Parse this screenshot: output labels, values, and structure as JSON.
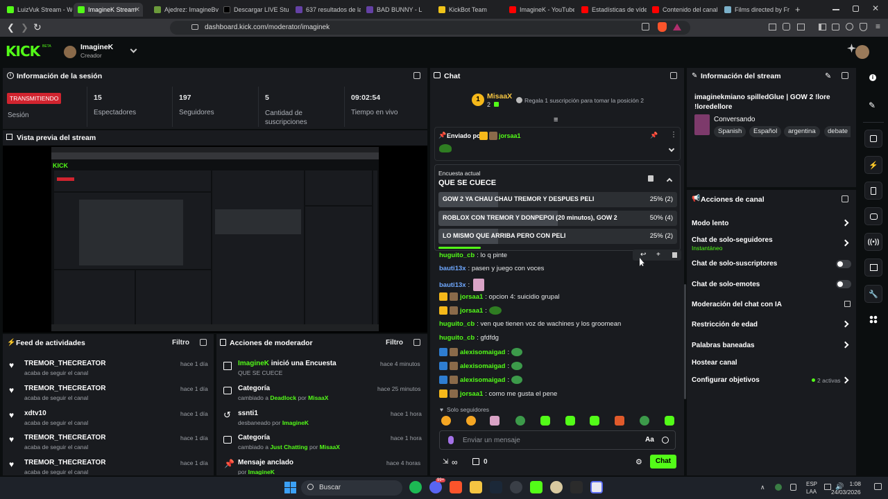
{
  "browser": {
    "tabs": [
      {
        "label": "LuizVuk Stream - W",
        "color": "#53fc18"
      },
      {
        "label": "ImagineK Stream",
        "color": "#53fc18"
      },
      {
        "label": "Ajedrez: ImagineBv",
        "color": "#6b9a3b"
      },
      {
        "label": "Descargar LIVE Stud",
        "color": "#000000"
      },
      {
        "label": "637 resultados de la",
        "color": "#6441a5"
      },
      {
        "label": "BAD BUNNY - L",
        "color": "#6441a5"
      },
      {
        "label": "KickBot Team",
        "color": "#f0c419"
      },
      {
        "label": "ImagineK - YouTube",
        "color": "#ff0000"
      },
      {
        "label": "Estadísticas de víde",
        "color": "#ff0000"
      },
      {
        "label": "Contenido del canal",
        "color": "#ff0000"
      },
      {
        "label": "Films directed by Fr",
        "color": "#7bb0c9"
      }
    ],
    "url": "dashboard.kick.com/moderator/imaginek"
  },
  "header": {
    "logo": "KICK",
    "logo_beta": "BETA",
    "user": "ImagineK",
    "role": "Creador"
  },
  "session": {
    "title": "Información de la sesión",
    "live_badge": "TRANSMITIENDO",
    "session_label": "Sesión",
    "stats": [
      {
        "value": "15",
        "label": "Espectadores"
      },
      {
        "value": "197",
        "label": "Seguidores"
      },
      {
        "value": "5",
        "label": "Cantidad de suscripciones"
      },
      {
        "value": "09:02:54",
        "label": "Tiempo en vivo"
      }
    ]
  },
  "preview": {
    "title": "Vista previa del stream"
  },
  "activity": {
    "title": "Feed de actividades",
    "filter": "Filtro",
    "items": [
      {
        "name": "TREMOR_THECREATOR",
        "sub": "acaba de seguir el canal",
        "time": "hace 1 día"
      },
      {
        "name": "TREMOR_THECREATOR",
        "sub": "acaba de seguir el canal",
        "time": "hace 1 día"
      },
      {
        "name": "xdtv10",
        "sub": "acaba de seguir el canal",
        "time": "hace 1 día"
      },
      {
        "name": "TREMOR_THECREATOR",
        "sub": "acaba de seguir el canal",
        "time": "hace 1 día"
      },
      {
        "name": "TREMOR_THECREATOR",
        "sub": "acaba de seguir el canal",
        "time": "hace 1 día"
      }
    ]
  },
  "modactions": {
    "title": "Acciones de moderador",
    "filter": "Filtro",
    "items": [
      {
        "title_user": "ImagineK",
        "title_rest": " inició una Encuesta",
        "sub_pre": "QUE SE CUECE",
        "sub_hl": "",
        "sub_mid": "",
        "sub_hl2": "",
        "time": "hace 4 minutos"
      },
      {
        "title_user": "",
        "title_rest": "Categoría",
        "sub_pre": "cambiado a ",
        "sub_hl": "Deadlock",
        "sub_mid": " por ",
        "sub_hl2": "MisaaX",
        "time": "hace 25 minutos"
      },
      {
        "title_user": "",
        "title_rest": "ssnti1",
        "sub_pre": "desbaneado por ",
        "sub_hl": "ImagineK",
        "sub_mid": "",
        "sub_hl2": "",
        "time": "hace 1 hora"
      },
      {
        "title_user": "",
        "title_rest": "Categoría",
        "sub_pre": "cambiado a ",
        "sub_hl": "Just Chatting",
        "sub_mid": " por ",
        "sub_hl2": "MisaaX",
        "time": "hace 1 hora"
      },
      {
        "title_user": "",
        "title_rest": "Mensaje anclado",
        "sub_pre": "por ",
        "sub_hl": "ImagineK",
        "sub_mid": "",
        "sub_hl2": "",
        "time": "hace 4 horas"
      }
    ]
  },
  "chat": {
    "title": "Chat",
    "top_gifter": "MisaaX",
    "top_gifter_count": "2",
    "gift_text": "Regala 1 suscripción para tomar la posición 2",
    "pinned_label": "Enviado por",
    "pinned_user": "jorsaa1",
    "poll": {
      "label": "Encuesta actual",
      "question": "QUE SE CUECE",
      "options": [
        {
          "text": "GOW 2 YA CHAU CHAU TREMOR Y DESPUES PELI",
          "pct": "25% (2)",
          "value": 0.25
        },
        {
          "text": "ROBLOX CON TREMOR Y DONPEPOI (20 minutos), GOW 2",
          "pct": "50% (4)",
          "value": 0.5
        },
        {
          "text": "LO MISMO QUE ARRIBA PERO CON PELI",
          "pct": "25% (2)",
          "value": 0.25
        }
      ]
    },
    "messages": [
      {
        "user": "huguito_cb",
        "color": "#53fc18",
        "text": ": lo q pinte"
      },
      {
        "user": "bauti13x",
        "color": "#6fa8ff",
        "text": ": pasen y juego con voces"
      },
      {
        "user": "bauti13x",
        "color": "#6fa8ff",
        "text": ":"
      },
      {
        "user": "jorsaa1",
        "color": "#53fc18",
        "text": ": opcion 4: suicidio grupal"
      },
      {
        "user": "jorsaa1",
        "color": "#53fc18",
        "text": ":"
      },
      {
        "user": "huguito_cb",
        "color": "#53fc18",
        "text": ": ven que tienen voz de wachines y los groomean"
      },
      {
        "user": "huguito_cb",
        "color": "#53fc18",
        "text": ": gfdfdg"
      },
      {
        "user": "alexisomaigad",
        "color": "#53fc18",
        "text": ":"
      },
      {
        "user": "alexisomaigad",
        "color": "#53fc18",
        "text": ":"
      },
      {
        "user": "alexisomaigad",
        "color": "#53fc18",
        "text": ":"
      },
      {
        "user": "jorsaa1",
        "color": "#53fc18",
        "text": ": como me gusta el pene"
      }
    ],
    "followers_only": "Solo seguidores",
    "input_placeholder": "Enviar un mensaje",
    "count": "0",
    "send": "Chat"
  },
  "streaminfo": {
    "title": "Información del stream",
    "stream_title": "imaginekmiano spilledGlue | GOW 2 !lore !loredellore",
    "category": "Conversando",
    "tags": [
      "Spanish",
      "Español",
      "argentina",
      "debate"
    ]
  },
  "channel": {
    "title": "Acciones de canal",
    "items": [
      {
        "label": "Modo lento",
        "sub": "",
        "control": "chevron"
      },
      {
        "label": "Chat de solo-seguidores",
        "sub": "Instantáneo",
        "control": "chevron"
      },
      {
        "label": "Chat de solo-suscriptores",
        "sub": "",
        "control": "toggle"
      },
      {
        "label": "Chat de solo-emotes",
        "sub": "",
        "control": "toggle"
      },
      {
        "label": "Moderación del chat con IA",
        "sub": "",
        "control": "external"
      },
      {
        "label": "Restricción de edad",
        "sub": "",
        "control": "chevron"
      },
      {
        "label": "Palabras baneadas",
        "sub": "",
        "control": "chevron"
      },
      {
        "label": "Hostear canal",
        "sub": "",
        "control": "none"
      },
      {
        "label": "Configurar objetivos",
        "sub": "2 activas",
        "control": "chevron"
      }
    ]
  },
  "taskbar": {
    "search": "Buscar",
    "lang": "ESP",
    "lang2": "LAA",
    "time": "1:08",
    "date": "24/03/2026",
    "badge": "99+"
  }
}
